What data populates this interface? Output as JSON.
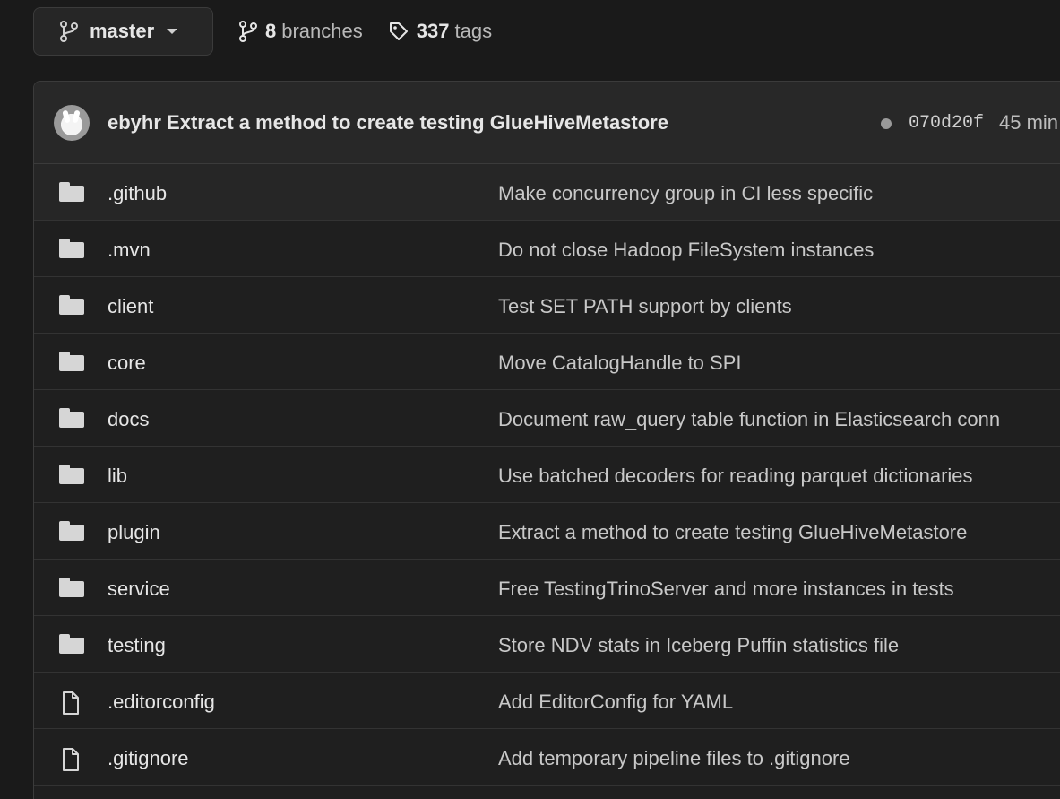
{
  "topbar": {
    "branch": "master",
    "branches_count": "8",
    "branches_label": "branches",
    "tags_count": "337",
    "tags_label": "tags"
  },
  "latest_commit": {
    "author": "ebyhr",
    "message": "Extract a method to create testing GlueHiveMetastore",
    "sha": "070d20f",
    "time": "45 min"
  },
  "files": [
    {
      "type": "folder",
      "icon": "folder-icon",
      "name": ".github",
      "commit": "Make concurrency group in CI less specific"
    },
    {
      "type": "folder",
      "icon": "folder-icon",
      "name": ".mvn",
      "commit": "Do not close Hadoop FileSystem instances"
    },
    {
      "type": "folder",
      "icon": "folder-icon",
      "name": "client",
      "commit": "Test SET PATH support by clients"
    },
    {
      "type": "folder",
      "icon": "folder-icon",
      "name": "core",
      "commit": "Move CatalogHandle to SPI"
    },
    {
      "type": "folder",
      "icon": "folder-icon",
      "name": "docs",
      "commit": "Document raw_query table function in Elasticsearch conn"
    },
    {
      "type": "folder",
      "icon": "folder-icon",
      "name": "lib",
      "commit": "Use batched decoders for reading parquet dictionaries"
    },
    {
      "type": "folder",
      "icon": "folder-icon",
      "name": "plugin",
      "commit": "Extract a method to create testing GlueHiveMetastore"
    },
    {
      "type": "folder",
      "icon": "folder-icon",
      "name": "service",
      "commit": "Free TestingTrinoServer and more instances in tests"
    },
    {
      "type": "folder",
      "icon": "folder-icon",
      "name": "testing",
      "commit": "Store NDV stats in Iceberg Puffin statistics file"
    },
    {
      "type": "file",
      "icon": "file-icon",
      "name": ".editorconfig",
      "commit": "Add EditorConfig for YAML"
    },
    {
      "type": "file",
      "icon": "file-icon",
      "name": ".gitignore",
      "commit": "Add temporary pipeline files to .gitignore"
    }
  ]
}
